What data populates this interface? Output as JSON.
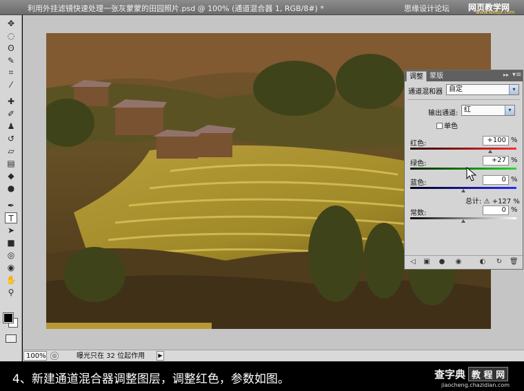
{
  "window": {
    "title": "利用外挂滤镜快速处理一张灰蒙蒙的田园照片.psd @ 100% (通道混合器 1, RGB/8#) *",
    "close_glyph": "✕"
  },
  "watermark": {
    "forum": "思缘设计论坛",
    "site": "网页教学网",
    "url": "www.webjx.com"
  },
  "toolbar": {
    "tools": [
      {
        "icon": "move-tool-icon",
        "glyph": "✥"
      },
      {
        "icon": "marquee-tool-icon",
        "glyph": "◌"
      },
      {
        "icon": "lasso-tool-icon",
        "glyph": "ʘ"
      },
      {
        "icon": "quick-select-icon",
        "glyph": "✎"
      },
      {
        "icon": "crop-tool-icon",
        "glyph": "⌗"
      },
      {
        "icon": "eyedropper-icon",
        "glyph": "⁄"
      },
      {
        "icon": "healing-brush-icon",
        "glyph": "✚"
      },
      {
        "icon": "brush-tool-icon",
        "glyph": "✐"
      },
      {
        "icon": "clone-stamp-icon",
        "glyph": "♟"
      },
      {
        "icon": "history-brush-icon",
        "glyph": "↺"
      },
      {
        "icon": "eraser-icon",
        "glyph": "▱"
      },
      {
        "icon": "gradient-tool-icon",
        "glyph": "▤"
      },
      {
        "icon": "blur-tool-icon",
        "glyph": "◆"
      },
      {
        "icon": "dodge-tool-icon",
        "glyph": "●"
      },
      {
        "icon": "pen-tool-icon",
        "glyph": "✒"
      },
      {
        "icon": "type-tool-icon",
        "glyph": "T"
      },
      {
        "icon": "path-select-icon",
        "glyph": "➤"
      },
      {
        "icon": "shape-tool-icon",
        "glyph": "■"
      },
      {
        "icon": "3d-rotate-icon",
        "glyph": "◎"
      },
      {
        "icon": "3d-orbit-icon",
        "glyph": "◉"
      },
      {
        "icon": "hand-tool-icon",
        "glyph": "✋"
      },
      {
        "icon": "zoom-tool-icon",
        "glyph": "⚲"
      }
    ],
    "active_tool": "type-tool-icon"
  },
  "status": {
    "zoom": "100%",
    "info": "曝光只在 32 位起作用",
    "nav_glyph": "◎",
    "arrow_glyph": "▶"
  },
  "caption": {
    "text": "4、新建通道混合器调整图层，调整红色，参数如图。",
    "logo_a": "查字典",
    "logo_b": "教 程 网",
    "logo_url": "jiaocheng.chazidian.com"
  },
  "panel": {
    "tabs": [
      "调整",
      "蒙版"
    ],
    "header_label": "通道混和器",
    "preset": "自定",
    "output_channel_label": "输出通道:",
    "output_channel": "红",
    "monochrome_label": "单色",
    "monochrome_checked": false,
    "sliders": [
      {
        "label": "红色:",
        "value": "+100",
        "pct": "%",
        "fraction": 0.75,
        "from": "#2a0000",
        "to": "#ff2a2a"
      },
      {
        "label": "绿色:",
        "value": "+27",
        "pct": "%",
        "fraction": 0.56,
        "from": "#001a00",
        "to": "#22dd22"
      },
      {
        "label": "蓝色:",
        "value": "0",
        "pct": "%",
        "fraction": 0.5,
        "from": "#00001a",
        "to": "#2a2aff"
      },
      {
        "label": "常数:",
        "value": "0",
        "pct": "%",
        "fraction": 0.5,
        "from": "#000000",
        "to": "#ffffff"
      }
    ],
    "total_label": "总计:",
    "total_value": "+127",
    "total_pct": "%",
    "warning_glyph": "⚠",
    "chevron_glyph": "▾",
    "collapse_glyph": "▸▸",
    "menu_glyph": "▾≡",
    "bottom_icons": [
      {
        "name": "back-arrow-icon",
        "glyph": "◁"
      },
      {
        "name": "expand-view-icon",
        "glyph": "▣"
      },
      {
        "name": "clip-layer-icon",
        "glyph": "●"
      },
      {
        "name": "visibility-eye-icon",
        "glyph": "◉"
      },
      {
        "name": "view-previous-icon",
        "glyph": "◐"
      },
      {
        "name": "reset-icon",
        "glyph": "↻"
      },
      {
        "name": "trash-icon",
        "glyph": "🗑"
      }
    ]
  }
}
